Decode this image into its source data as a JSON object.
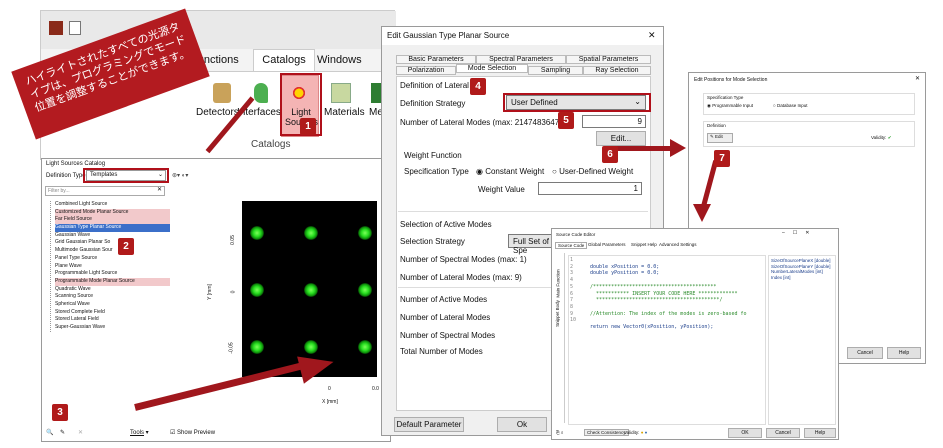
{
  "ribbon": {
    "tabs": [
      "Functions",
      "Catalogs",
      "Windows"
    ],
    "groups": [
      "Detectors",
      "Interfaces",
      "Light Sources",
      "Materials",
      "Med"
    ],
    "group_caption": "Catalogs"
  },
  "callout": {
    "text": "ハイライトされたすべての光源タイプは、プログラミングでモード位置を調整することができます。"
  },
  "catalog": {
    "title": "Light Sources Catalog",
    "def_type_label": "Definition Type",
    "def_type_value": "Templates",
    "filter_placeholder": "Filter by...",
    "items": [
      "Combined Light Source",
      "Customized Mode Planar Source",
      "Far Field Source",
      "Gaussian Type Planar Source",
      "Gaussian Wave",
      "Grid Gaussian Planar So",
      "Multimode Gaussian Sour",
      "Panel Type Source",
      "Plane Wave",
      "Programmable Light Source",
      "Programmable Mode Planar Source",
      "Quadratic Wave",
      "Scanning Source",
      "Spherical Wave",
      "Stored Complete Field",
      "Stored Lateral Field",
      "Super-Gaussian Wave"
    ],
    "tools_label": "Tools",
    "show_preview": "Show Preview"
  },
  "plot": {
    "ylabel": "Y [mm]",
    "xlabel": "X [mm]",
    "yticks": [
      "0.05",
      "0",
      "-0.05"
    ],
    "xticks": [
      "0",
      "0.0"
    ]
  },
  "edit_dialog": {
    "title": "Edit Gaussian Type Planar Source",
    "tabs_row1": [
      "Basic Parameters",
      "Spectral Parameters",
      "Spatial Parameters"
    ],
    "tabs_row2": [
      "Polarization",
      "Mode Selection",
      "Sampling",
      "Ray Selection"
    ],
    "def_lateral": "Definition of Lateral M",
    "strategy_label": "Definition Strategy",
    "strategy_value": "User Defined",
    "num_modes_label": "Number of Lateral Modes (max: 2147483647)",
    "num_modes_value": "9",
    "edit_btn": "Edit...",
    "weight_fn": "Weight Function",
    "spec_type": "Specification Type",
    "const_weight": "Constant Weight",
    "user_weight": "User-Defined Weight",
    "weight_value_label": "Weight Value",
    "weight_value": "1",
    "sel_active": "Selection of Active Modes",
    "sel_strategy": "Selection Strategy",
    "sel_strategy_value": "Full Set of Spe",
    "num_spectral": "Number of Spectral Modes (max: 1)",
    "num_lateral9": "Number of Lateral Modes (max: 9)",
    "num_active": "Number of Active Modes",
    "num_lateral": "Number of Lateral Modes",
    "num_spec": "Number of Spectral Modes",
    "total": "Total Number of Modes",
    "default_btn": "Default Parameter",
    "ok_btn": "Ok"
  },
  "positions": {
    "title": "Edit Positions for Mode Selection",
    "spec_type": "Specification Type",
    "prog": "Programmable Input",
    "db": "Database Input",
    "definition": "Definition",
    "edit": "Edit",
    "validity": "Validity:",
    "cancel": "Cancel",
    "help": "Help"
  },
  "code": {
    "title": "Source Code Editor",
    "tabs": [
      "Source Code",
      "Global Parameters",
      "Snippet Help",
      "Advanced Settings"
    ],
    "lines": [
      "double xPosition = 0.0;",
      "double yPosition = 0.0;",
      "",
      "/*****************************************",
      "  *********** INSERT YOUR CODE HERE *************",
      "  *****************************************/",
      "",
      "//Attention: The index of the modes is zero-based fo",
      "",
      "return new Vector0(xPosition, yPosition);"
    ],
    "params": [
      "SizeOfSourcePlaneX [double]",
      "SizeOfSourcePlaneY [double]",
      "NumberLateralModes [int]",
      "Index [int]"
    ],
    "side": [
      "Main Function",
      "Snippet Body"
    ],
    "check": "Check Consistency",
    "validity": "Validity:",
    "ok": "OK",
    "cancel": "Cancel",
    "help": "Help"
  },
  "badges": [
    "1",
    "2",
    "3",
    "4",
    "5",
    "6",
    "7"
  ]
}
